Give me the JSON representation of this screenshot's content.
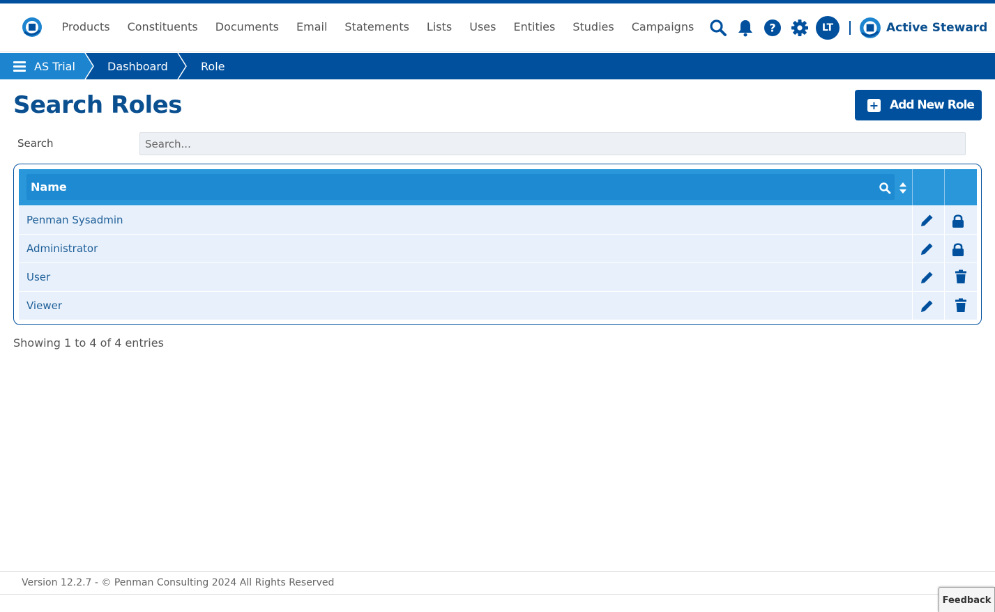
{
  "colors": {
    "primary": "#00509e",
    "accent": "#1d84cf",
    "header_row": "#2a97da",
    "row_bg": "#e8f1fb"
  },
  "topbar": {
    "logo_icon": "active-steward-logo",
    "nav": [
      "Products",
      "Constituents",
      "Documents",
      "Email",
      "Statements",
      "Lists",
      "Uses",
      "Entities",
      "Studies",
      "Campaigns"
    ],
    "icons": [
      "search-icon",
      "bell-icon",
      "help-icon",
      "gear-icon"
    ],
    "avatar_initials": "LT",
    "brand_name": "Active Steward"
  },
  "breadcrumb": {
    "items": [
      "AS Trial",
      "Dashboard",
      "Role"
    ]
  },
  "page": {
    "title": "Search Roles",
    "add_button_label": "Add New Role",
    "search_label": "Search",
    "search_placeholder": "Search..."
  },
  "table": {
    "header_name": "Name",
    "rows": [
      {
        "name": "Penman Sysadmin",
        "edit_icon": "pencil-icon",
        "second_icon": "lock-icon"
      },
      {
        "name": "Administrator",
        "edit_icon": "pencil-icon",
        "second_icon": "lock-icon"
      },
      {
        "name": "User",
        "edit_icon": "pencil-icon",
        "second_icon": "trash-icon"
      },
      {
        "name": "Viewer",
        "edit_icon": "pencil-icon",
        "second_icon": "trash-icon"
      }
    ],
    "showing_text": "Showing 1 to 4 of 4 entries"
  },
  "footer": {
    "text": "Version 12.2.7 - © Penman Consulting 2024 All Rights Reserved",
    "feedback_label": "Feedback"
  }
}
